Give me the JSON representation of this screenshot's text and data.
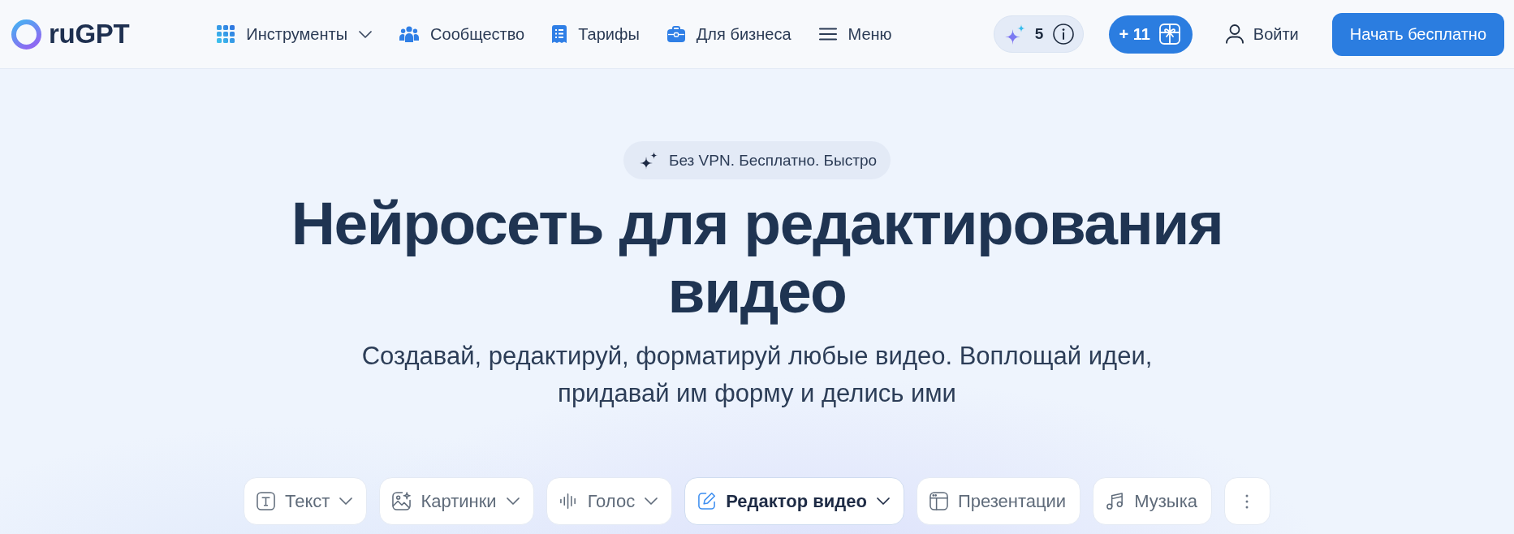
{
  "header": {
    "logo": {
      "text": "ruGPT"
    },
    "nav": [
      {
        "label": "Инструменты",
        "kind": "dropdown"
      },
      {
        "label": "Сообщество",
        "kind": "link"
      },
      {
        "label": "Тарифы",
        "kind": "link"
      },
      {
        "label": "Для бизнеса",
        "kind": "link"
      },
      {
        "label": "Меню",
        "kind": "link"
      }
    ],
    "credits": {
      "count": "5"
    },
    "bonus": {
      "label": "+ 11"
    },
    "login": {
      "label": "Войти"
    },
    "cta": {
      "label": "Начать бесплатно"
    }
  },
  "hero": {
    "badge": "Без VPN. Бесплатно. Быстро",
    "title": "Нейросеть для редактирования видео",
    "subtitle": "Создавай, редактируй, форматируй любые видео. Воплощай идеи, придавай им форму и делись ими"
  },
  "tabs": [
    {
      "label": "Текст",
      "kind": "dropdown",
      "selected": false
    },
    {
      "label": "Картинки",
      "kind": "dropdown",
      "selected": false
    },
    {
      "label": "Голос",
      "kind": "dropdown",
      "selected": false
    },
    {
      "label": "Редактор видео",
      "kind": "dropdown",
      "selected": true
    },
    {
      "label": "Презентации",
      "kind": "plain",
      "selected": false
    },
    {
      "label": "Музыка",
      "kind": "plain",
      "selected": false
    },
    {
      "kind": "more",
      "selected": false
    }
  ]
}
